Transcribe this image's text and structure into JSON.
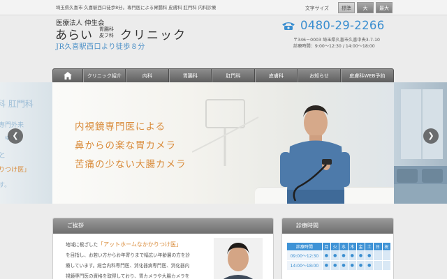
{
  "topbar": {
    "tagline": "埼玉県久喜市 久喜駅西口徒歩8分。専門医による胃腸科 皮膚科 肛門科 内科診療",
    "font_size_label": "文字サイズ",
    "font_sizes": [
      "標準",
      "大",
      "最大"
    ],
    "selected_font_size": "標準"
  },
  "logo": {
    "sub": "医療法人 伸生会",
    "name_part1": "あらい",
    "dept_line1": "胃腸科",
    "dept_line2": "皮フ科",
    "name_part2": "クリニック",
    "access": "JR久喜駅西口より徒歩８分"
  },
  "contact": {
    "phone_icon": "phone-icon",
    "phone": "0480-29-2266",
    "address": "〒346－0003 埼玉県久喜市久喜中央3-7-10",
    "hours": "診療時間：9:00～12:30 / 14:00～18:00"
  },
  "nav": {
    "home_icon": "home-icon",
    "items": [
      "クリニック紹介",
      "内科",
      "胃腸科",
      "肛門科",
      "皮膚科",
      "お知らせ",
      "皮膚科WEB予約"
    ]
  },
  "hero": {
    "line1": "内視鏡専門医による",
    "line2": "鼻からの楽な胃カメラ",
    "line3": "苦痛の少ない大腸カメラ",
    "ghost_lines": [
      "科 肛門科",
      "専門外来",
      "ゅう）",
      "と",
      "りつけ医」",
      "す。"
    ],
    "prev_icon": "chevron-left-icon",
    "next_icon": "chevron-right-icon"
  },
  "greeting": {
    "title": "ご挨拶",
    "lead": "地域に根ざした",
    "highlight": "「アットホームなかかりつけ医」",
    "line2": "を目指し、お若い方からお年寄りまで幅広い年齢層の方を診",
    "line3": "療しています。総合内科専門医、消化器病専門医、消化器内",
    "line4": "視鏡専門医の資格を取得しており、胃カメラや大腸カメラを"
  },
  "schedule": {
    "title": "診療時間",
    "header": [
      "診療時間",
      "月",
      "火",
      "水",
      "木",
      "金",
      "土",
      "日",
      "祝"
    ],
    "rows": [
      {
        "time": "09:00～12:30",
        "marks": [
          "●",
          "●",
          "●",
          "●",
          "●",
          "●",
          "",
          ""
        ]
      },
      {
        "time": "14:00～18:00",
        "marks": [
          "●",
          "●",
          "●",
          "●",
          "●",
          "●",
          "",
          ""
        ]
      }
    ]
  },
  "colors": {
    "accent_blue": "#3a8ed0",
    "hero_orange": "#d98b3a",
    "nav_gray": "#6e6e6e"
  }
}
